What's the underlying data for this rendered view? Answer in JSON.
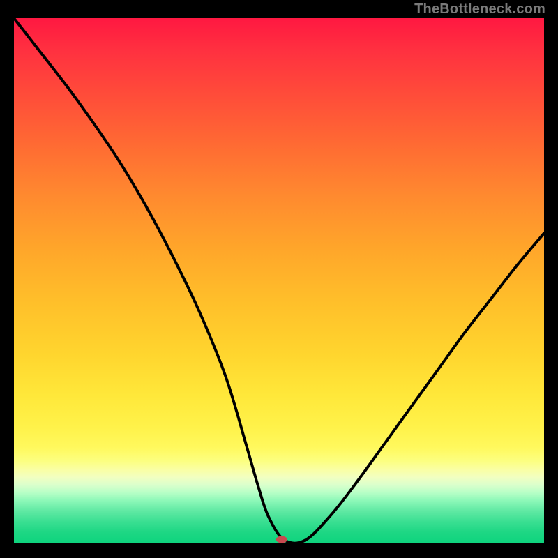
{
  "watermark": "TheBottleneck.com",
  "chart_data": {
    "type": "line",
    "title": "",
    "xlabel": "",
    "ylabel": "",
    "xlim": [
      0,
      100
    ],
    "ylim": [
      0,
      100
    ],
    "grid": false,
    "legend": false,
    "annotations": [],
    "series": [
      {
        "name": "bottleneck-curve",
        "x": [
          0,
          5,
          10,
          15,
          20,
          25,
          30,
          35,
          40,
          44,
          46,
          48,
          51,
          55,
          60,
          65,
          70,
          75,
          80,
          85,
          90,
          95,
          100
        ],
        "y": [
          100,
          93.5,
          87,
          80,
          72.5,
          64,
          54.5,
          44,
          31.5,
          18,
          11,
          5,
          0.5,
          0.5,
          5.5,
          12,
          19,
          26,
          33,
          40,
          46.5,
          53,
          59
        ]
      }
    ],
    "marker": {
      "x": 50.5,
      "y": 0.6,
      "color": "#c74a4f",
      "rx": 8,
      "ry": 5
    }
  },
  "colors": {
    "curve_stroke": "#000000",
    "marker_fill": "#c74a4f",
    "background_black": "#000000"
  }
}
